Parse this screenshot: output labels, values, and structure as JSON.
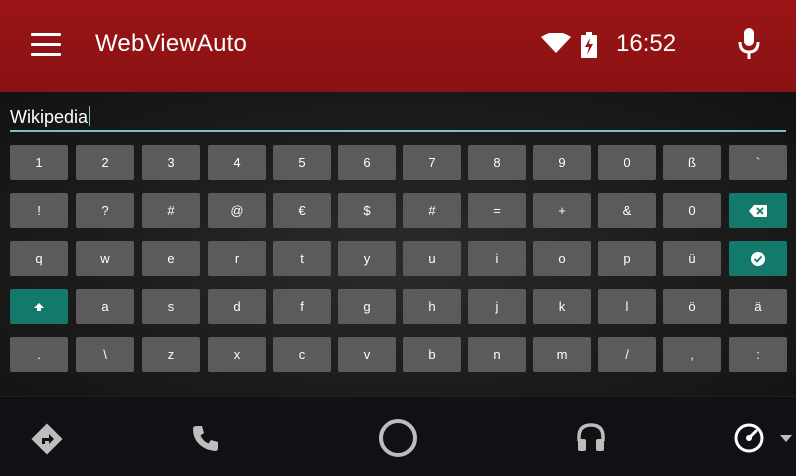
{
  "header": {
    "title": "WebViewAuto",
    "time": "16:52",
    "icons": [
      "menu-icon",
      "wifi-icon",
      "battery-charging-icon",
      "microphone-icon"
    ]
  },
  "input": {
    "value": "Wikipedia"
  },
  "keyboard": {
    "rows": [
      [
        "1",
        "2",
        "3",
        "4",
        "5",
        "6",
        "7",
        "8",
        "9",
        "0",
        "ß",
        "`"
      ],
      [
        "!",
        "?",
        "#",
        "@",
        "€",
        "$",
        "#",
        "=",
        "+",
        "&",
        "0",
        ""
      ],
      [
        "q",
        "w",
        "e",
        "r",
        "t",
        "y",
        "u",
        "i",
        "o",
        "p",
        "ü",
        ""
      ],
      [
        "",
        "a",
        "s",
        "d",
        "f",
        "g",
        "h",
        "j",
        "k",
        "l",
        "ö",
        "ä"
      ],
      [
        ".",
        "\\",
        "z",
        "x",
        "c",
        "v",
        "b",
        "n",
        "m",
        "/",
        ",",
        ":"
      ]
    ],
    "special_keys": {
      "backspace_icon": "backspace-icon",
      "enter_icon": "checkmark-icon",
      "shift_icon": "shift-icon"
    },
    "accent_color": "#13796b"
  },
  "bottom_nav": {
    "items": [
      "navigation-icon",
      "phone-icon",
      "home-icon",
      "headphones-icon",
      "dashboard-gauge-icon"
    ]
  },
  "colors": {
    "header": "#9a1416",
    "key": "#5c5a5c",
    "input_underline": "#79c2c0"
  }
}
